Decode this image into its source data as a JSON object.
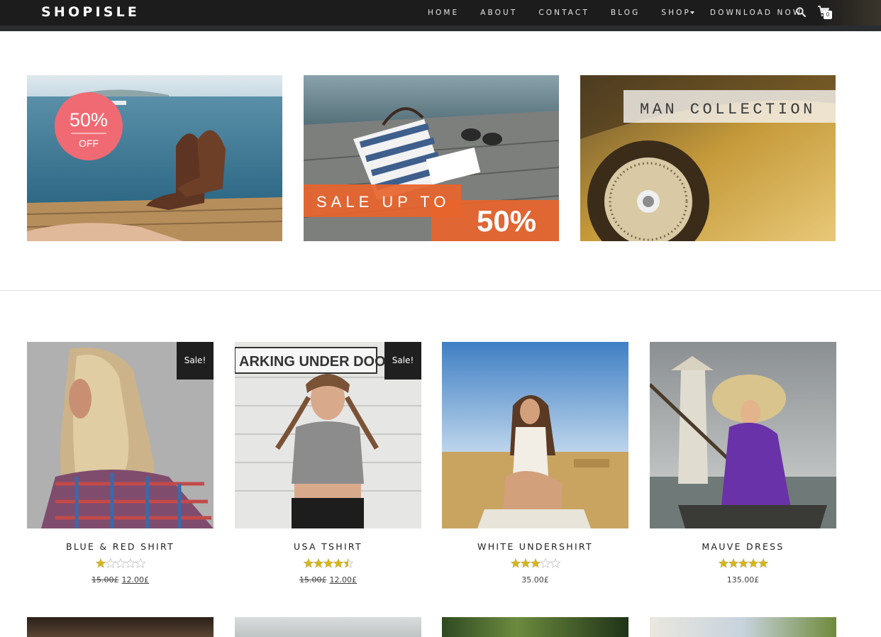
{
  "header": {
    "logo": "SHOPISLE",
    "nav": [
      "HOME",
      "ABOUT",
      "CONTACT",
      "BLOG",
      "SHOP",
      "DOWNLOAD NOW"
    ],
    "cart_count": "0"
  },
  "banners": [
    {
      "badge_value": "50%",
      "badge_text": "OFF"
    },
    {
      "text_top": "SALE UP TO",
      "text_value": "50%"
    },
    {
      "text": "MAN COLLECTION"
    }
  ],
  "products": [
    {
      "name": "BLUE & RED SHIRT",
      "rating": 1,
      "old_price": "15.00£",
      "price": "12.00£",
      "sale": "Sale!"
    },
    {
      "name": "USA TSHIRT",
      "rating": 4.5,
      "old_price": "15.00£",
      "price": "12.00£",
      "sale": "Sale!"
    },
    {
      "name": "WHITE UNDERSHIRT",
      "rating": 3,
      "old_price": "",
      "price": "35.00£",
      "sale": ""
    },
    {
      "name": "MAUVE DRESS",
      "rating": 5,
      "old_price": "",
      "price": "135.00£",
      "sale": ""
    }
  ],
  "colors": {
    "header_bg": "#1c1c1c",
    "sale_badge": "#1f1f1f",
    "star": "#d4b61a",
    "banner_orange": "#e8642d",
    "badge_pink": "#f06a73"
  }
}
